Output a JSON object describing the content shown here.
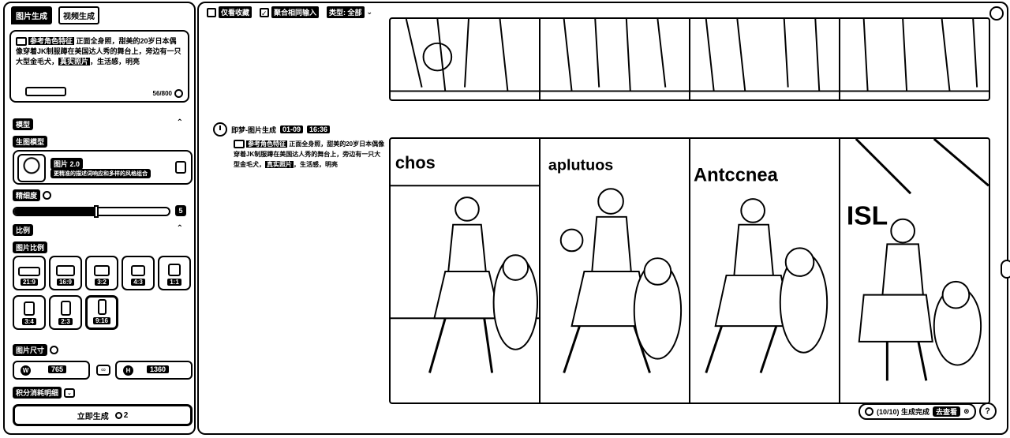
{
  "left_panel": {
    "tabs": [
      {
        "label": "图片生成",
        "active": true
      },
      {
        "label": "视频生成",
        "active": false
      }
    ],
    "prompt": {
      "segments": [
        {
          "text": "参考角色特征",
          "hl": true
        },
        {
          "text": " 正面全身照，甜美的20岁日本偶像穿着JK制服蹲在美国达人秀的舞台上，旁边有一只大型金毛犬，",
          "hl": false
        },
        {
          "text": "真实照片",
          "hl": true
        },
        {
          "text": "，生活感，明亮",
          "hl": false
        }
      ],
      "count": "56/800"
    },
    "model_section": {
      "label": "模型",
      "sub_label": "生图模型",
      "model_name": "图片 2.0",
      "model_desc": "更精准的描述词响应和多样的风格组合"
    },
    "detail": {
      "label": "精细度",
      "value": "5",
      "fraction": 0.53
    },
    "ratio_section": {
      "label": "比例",
      "sub_label": "图片比例",
      "options": [
        {
          "label": "21:9"
        },
        {
          "label": "16:9"
        },
        {
          "label": "3:2"
        },
        {
          "label": "4:3"
        },
        {
          "label": "1:1"
        },
        {
          "label": "3:4"
        },
        {
          "label": "2:3"
        },
        {
          "label": "9:16",
          "selected": true
        }
      ]
    },
    "size": {
      "label": "图片尺寸",
      "width_prefix": "W",
      "width": "765",
      "height_prefix": "H",
      "height": "1360",
      "link_icon": "link-icon"
    },
    "credits": {
      "label": "积分消耗明细"
    },
    "generate": {
      "label": "立即生成",
      "cost": "2"
    }
  },
  "main": {
    "toolbar": {
      "favorites": "仅看收藏",
      "merge": "聚合相同输入",
      "filter": "类型: 全部"
    },
    "generation": {
      "title": "即梦-图片生成",
      "date": "01-09",
      "time": "16:36",
      "prompt_segments": [
        {
          "text": "参考角色特征",
          "hl": true
        },
        {
          "text": " 正面全身照，甜美的20岁日本偶像穿着JK制服蹲在美国达人秀的舞台上，旁边有一只大型金毛犬，",
          "hl": false
        },
        {
          "text": "真实照片",
          "hl": true
        },
        {
          "text": "，生活感，明亮",
          "hl": false
        }
      ],
      "banners": [
        "chos",
        "aplutuos",
        "Antccnea",
        "ISL"
      ]
    },
    "status": {
      "text": "(10/10) 生成完成",
      "button": "去查看",
      "help": "?"
    }
  }
}
